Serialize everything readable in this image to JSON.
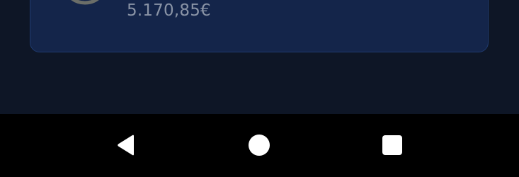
{
  "account_card": {
    "balance": "5.170,85€",
    "progress_ring_icon": "progress-ring-icon"
  },
  "navigation_bar": {
    "back_icon": "triangle-back-icon",
    "home_icon": "circle-home-icon",
    "recents_icon": "square-recents-icon"
  },
  "colors": {
    "background": "#0e1626",
    "card_background": "#14254a",
    "card_border": "#1f3a6e",
    "balance_text": "#8a94a6",
    "ring_stroke": "#6b6e68",
    "nav_background": "#000000",
    "nav_icons": "#ffffff"
  }
}
